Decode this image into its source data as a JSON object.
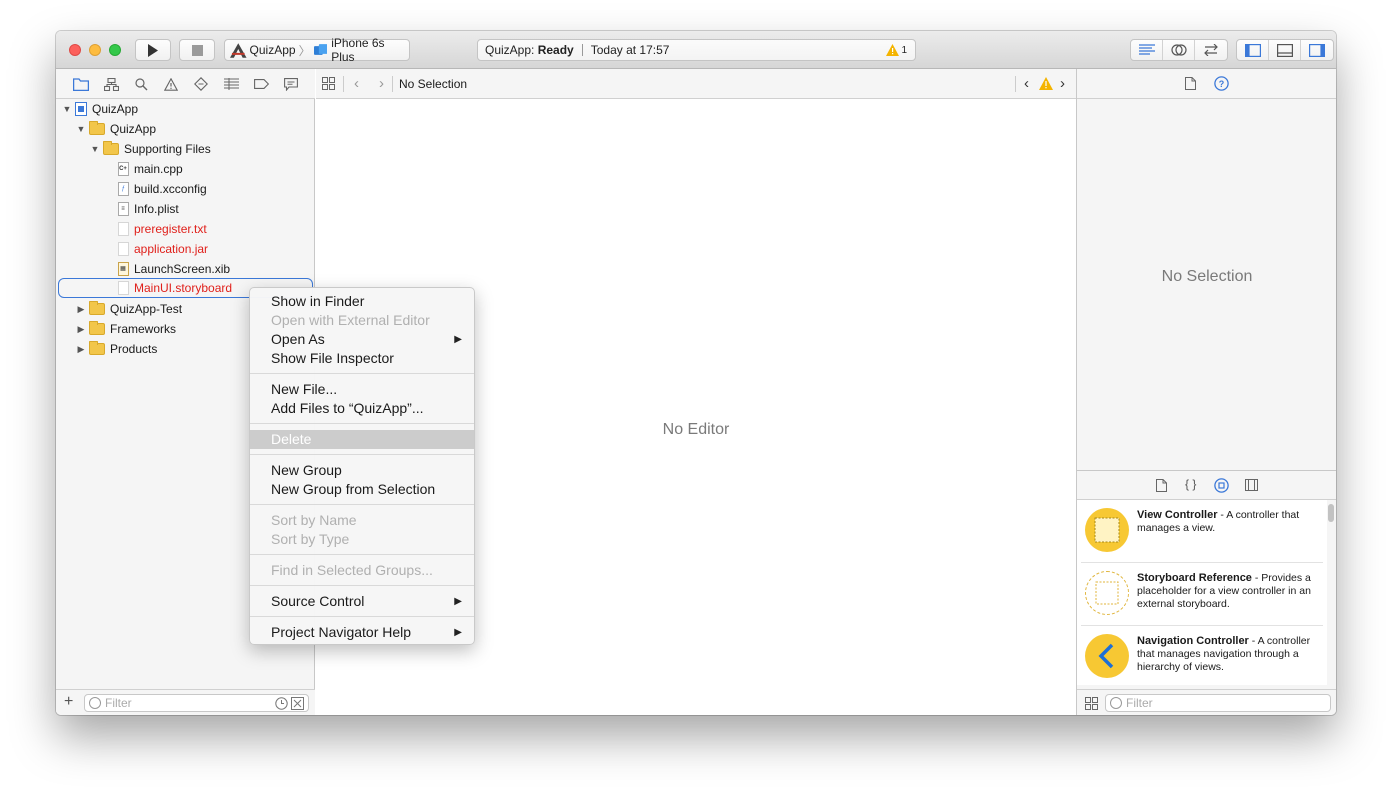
{
  "toolbar": {
    "scheme_project": "QuizApp",
    "scheme_device": "iPhone 6s Plus",
    "status_project": "QuizApp:",
    "status_state": "Ready",
    "status_time": "Today at 17:57",
    "warning_count": "1"
  },
  "navigator": {
    "tree": [
      {
        "label": "QuizApp",
        "level": 0,
        "kind": "project",
        "expanded": true
      },
      {
        "label": "QuizApp",
        "level": 1,
        "kind": "folder",
        "expanded": true
      },
      {
        "label": "Supporting Files",
        "level": 2,
        "kind": "folder",
        "expanded": true
      },
      {
        "label": "main.cpp",
        "level": 3,
        "kind": "file"
      },
      {
        "label": "build.xcconfig",
        "level": 3,
        "kind": "file"
      },
      {
        "label": "Info.plist",
        "level": 3,
        "kind": "file"
      },
      {
        "label": "preregister.txt",
        "level": 3,
        "kind": "file",
        "missing": true
      },
      {
        "label": "application.jar",
        "level": 3,
        "kind": "file",
        "missing": true
      },
      {
        "label": "LaunchScreen.xib",
        "level": 3,
        "kind": "file"
      },
      {
        "label": "MainUI.storyboard",
        "level": 3,
        "kind": "file",
        "missing": true,
        "selected": true
      },
      {
        "label": "QuizApp-Test",
        "level": 1,
        "kind": "folder",
        "expanded": false
      },
      {
        "label": "Frameworks",
        "level": 1,
        "kind": "folder",
        "expanded": false
      },
      {
        "label": "Products",
        "level": 1,
        "kind": "folder",
        "expanded": false
      }
    ],
    "filter_placeholder": "Filter"
  },
  "editor": {
    "jump_label": "No Selection",
    "empty_text": "No Editor"
  },
  "inspector": {
    "empty_text": "No Selection",
    "library": [
      {
        "title": "View Controller",
        "desc": " - A controller that manages a view."
      },
      {
        "title": "Storyboard Reference",
        "desc": " - Provides a placeholder for a view controller in an external storyboard."
      },
      {
        "title": "Navigation Controller",
        "desc": " - A controller that manages navigation through a hierarchy of views."
      }
    ],
    "filter_placeholder": "Filter"
  },
  "context_menu": {
    "groups": [
      [
        {
          "label": "Show in Finder",
          "enabled": true
        },
        {
          "label": "Open with External Editor",
          "enabled": false
        },
        {
          "label": "Open As",
          "enabled": true,
          "submenu": true
        },
        {
          "label": "Show File Inspector",
          "enabled": true
        }
      ],
      [
        {
          "label": "New File...",
          "enabled": true
        },
        {
          "label": "Add Files to “QuizApp”...",
          "enabled": true
        }
      ],
      [
        {
          "label": "Delete",
          "enabled": false,
          "highlighted": true
        }
      ],
      [
        {
          "label": "New Group",
          "enabled": true
        },
        {
          "label": "New Group from Selection",
          "enabled": true
        }
      ],
      [
        {
          "label": "Sort by Name",
          "enabled": false
        },
        {
          "label": "Sort by Type",
          "enabled": false
        }
      ],
      [
        {
          "label": "Find in Selected Groups...",
          "enabled": false
        }
      ],
      [
        {
          "label": "Source Control",
          "enabled": true,
          "submenu": true
        }
      ],
      [
        {
          "label": "Project Navigator Help",
          "enabled": true,
          "submenu": true
        }
      ]
    ]
  },
  "colors": {
    "accent": "#3b78d8",
    "missing_file": "#e0201b",
    "warning": "#f4b400"
  }
}
